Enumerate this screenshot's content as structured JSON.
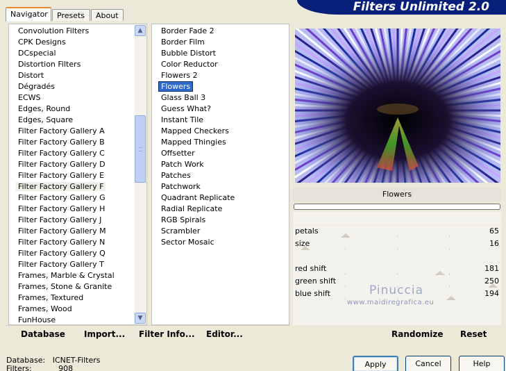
{
  "app_title": "Filters Unlimited 2.0",
  "tabs": [
    "Navigator",
    "Presets",
    "About"
  ],
  "categories": {
    "items": [
      "Convolution Filters",
      "CPK Designs",
      "DCspecial",
      "Distortion Filters",
      "Distort",
      "Dégradés",
      "ECWS",
      "Edges, Round",
      "Edges, Square",
      "Filter Factory Gallery A",
      "Filter Factory Gallery B",
      "Filter Factory Gallery C",
      "Filter Factory Gallery D",
      "Filter Factory Gallery E",
      "Filter Factory Gallery F",
      "Filter Factory Gallery G",
      "Filter Factory Gallery H",
      "Filter Factory Gallery J",
      "Filter Factory Gallery M",
      "Filter Factory Gallery N",
      "Filter Factory Gallery Q",
      "Filter Factory Gallery T",
      "Frames, Marble & Crystal",
      "Frames, Stone & Granite",
      "Frames, Textured",
      "Frames, Wood",
      "FunHouse"
    ],
    "selected": "Filter Factory Gallery F"
  },
  "filters": {
    "items": [
      "Border Fade 2",
      "Border Film",
      "Bubble Distort",
      "Color Reductor",
      "Flowers 2",
      "Flowers",
      "Glass Ball 3",
      "Guess What?",
      "Instant Tile",
      "Mapped Checkers",
      "Mapped Thingies",
      "Offsetter",
      "Patch Work",
      "Patches",
      "Patchwork",
      "Quadrant Replicate",
      "Radial Replicate",
      "RGB Spirals",
      "Scrambler",
      "Sector Mosaic"
    ],
    "selected": "Flowers"
  },
  "preview": {
    "filter_name": "Flowers"
  },
  "controls": {
    "petals": {
      "label": "petals",
      "value": "65"
    },
    "size": {
      "label": "size",
      "value": "16"
    },
    "red_shift": {
      "label": "red shift",
      "value": "181"
    },
    "green_shift": {
      "label": "green shift",
      "value": "250"
    },
    "blue_shift": {
      "label": "blue shift",
      "value": "194"
    }
  },
  "watermark": {
    "name": "Pinuccia",
    "url": "www.maidiregrafica.eu"
  },
  "buttons": {
    "database": "Database",
    "import": "Import...",
    "filter_info": "Filter Info...",
    "editor": "Editor...",
    "randomize": "Randomize",
    "reset": "Reset",
    "apply": "Apply",
    "cancel": "Cancel",
    "help": "Help"
  },
  "status": {
    "database_label": "Database:",
    "database_value": "ICNET-Filters",
    "filters_label": "Filters:",
    "filters_value": "908"
  },
  "colors": {
    "accent": "#08207a",
    "selection": "#3169c6"
  }
}
